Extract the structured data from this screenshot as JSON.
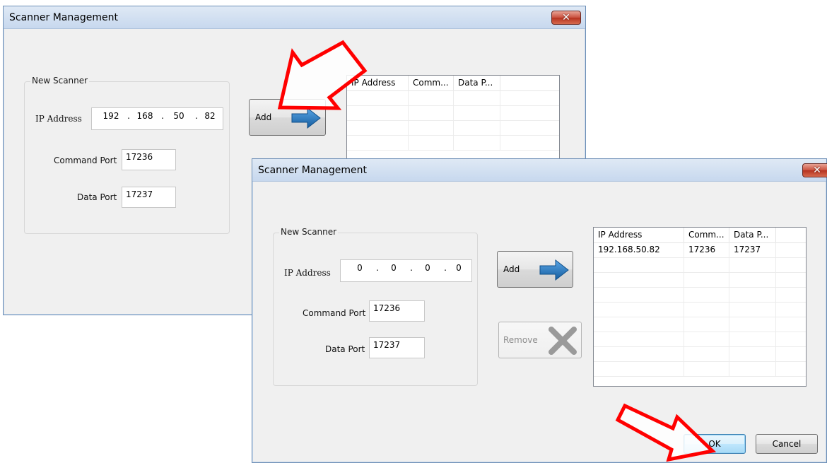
{
  "colors": {
    "annotation_arrow": "#ff0000",
    "arrow_icon": "#1f79c3",
    "close_button": "#c9503d"
  },
  "window_back": {
    "title": "Scanner Management",
    "close_glyph": "✕",
    "group_label": "New Scanner",
    "ip_label": "IP Address",
    "ip_octets": [
      "192",
      "168",
      "50",
      "82"
    ],
    "command_port_label": "Command Port",
    "command_port_value": "17236",
    "data_port_label": "Data Port",
    "data_port_value": "17237",
    "add_label": "Add",
    "columns": [
      "IP Address",
      "Comm...",
      "Data P..."
    ]
  },
  "window_front": {
    "title": "Scanner Management",
    "close_glyph": "✕",
    "group_label": "New Scanner",
    "ip_label": "IP Address",
    "ip_octets": [
      "0",
      "0",
      "0",
      "0"
    ],
    "command_port_label": "Command Port",
    "command_port_value": "17236",
    "data_port_label": "Data Port",
    "data_port_value": "17237",
    "add_label": "Add",
    "remove_label": "Remove",
    "columns": [
      "IP Address",
      "Comm...",
      "Data P..."
    ],
    "rows": [
      {
        "ip": "192.168.50.82",
        "command": "17236",
        "data": "17237"
      }
    ],
    "ok_label": "OK",
    "cancel_label": "Cancel"
  }
}
